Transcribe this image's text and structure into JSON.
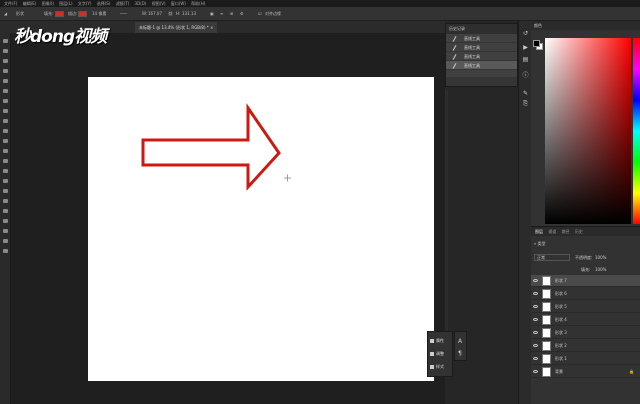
{
  "menubar": {
    "items": [
      "文件(F)",
      "编辑(E)",
      "图像(I)",
      "图层(L)",
      "文字(Y)",
      "选择(S)",
      "滤镜(T)",
      "3D(D)",
      "视图(V)",
      "窗口(W)",
      "帮助(H)"
    ]
  },
  "options": {
    "shape_mode": "形状",
    "fill_label": "填充:",
    "stroke_label": "描边:",
    "stroke_width": "14 像素",
    "width_label": "W:",
    "width_value": "167.07",
    "height_label": "H:",
    "height_value": "131.13",
    "align_edges": "对齐边缘",
    "fill_color": "#d42e1e",
    "stroke_color": "#d42e1e"
  },
  "document": {
    "tab_label": "未标题-1 @ 13.4% (形状 1, RGB/8) *"
  },
  "history": {
    "title": "历史记录",
    "items": [
      {
        "label": "直线工具",
        "selected": false
      },
      {
        "label": "直线工具",
        "selected": false
      },
      {
        "label": "直线工具",
        "selected": false
      },
      {
        "label": "直线工具",
        "selected": true
      }
    ]
  },
  "watermark": {
    "text": "秒dong视频"
  },
  "color_panel": {
    "title": "颜色",
    "fg": "#000000",
    "bg": "#ffffff"
  },
  "layers": {
    "tabs": [
      "图层",
      "通道",
      "路径",
      "历史"
    ],
    "kind_label": "类型",
    "blend_mode": "正常",
    "opacity_label": "不透明度:",
    "opacity_value": "100%",
    "fill_label": "填充:",
    "fill_value": "100%",
    "items": [
      {
        "name": "形状 7",
        "selected": true
      },
      {
        "name": "形状 6",
        "selected": false
      },
      {
        "name": "形状 5",
        "selected": false
      },
      {
        "name": "形状 4",
        "selected": false
      },
      {
        "name": "形状 3",
        "selected": false
      },
      {
        "name": "形状 2",
        "selected": false
      },
      {
        "name": "形状 1",
        "selected": false
      },
      {
        "name": "背景",
        "selected": false
      }
    ]
  },
  "properties_panel": {
    "items": [
      "属性",
      "调整",
      "样式"
    ]
  },
  "canvas": {
    "shape_stroke": "#cc1a12"
  }
}
